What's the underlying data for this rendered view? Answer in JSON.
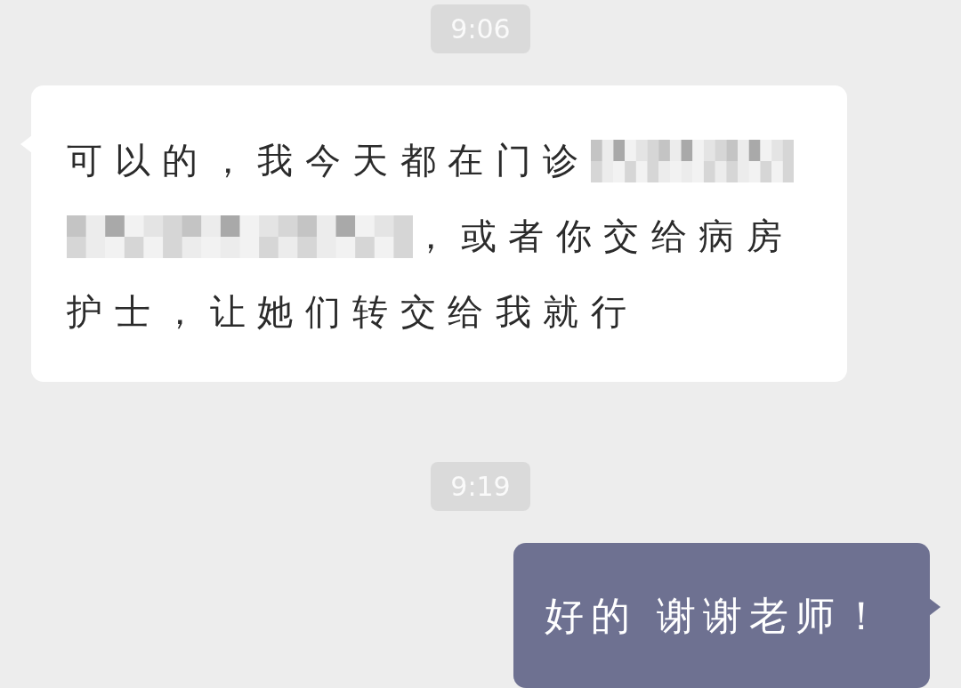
{
  "messages": [
    {
      "kind": "time",
      "text": "9:06"
    },
    {
      "kind": "incoming",
      "lines": [
        [
          {
            "kind": "text",
            "text": "可以的，我今天都在门诊"
          },
          {
            "kind": "redacted"
          }
        ],
        [
          {
            "kind": "redacted"
          },
          {
            "kind": "text",
            "text": "，或者你交给病房"
          }
        ],
        [
          {
            "kind": "text",
            "text": "护士，让她们转交给我就行"
          }
        ]
      ]
    },
    {
      "kind": "time",
      "text": "9:19"
    },
    {
      "kind": "outgoing",
      "lines": [
        [
          {
            "kind": "text",
            "text": "好的 谢谢老师！"
          }
        ]
      ]
    }
  ]
}
